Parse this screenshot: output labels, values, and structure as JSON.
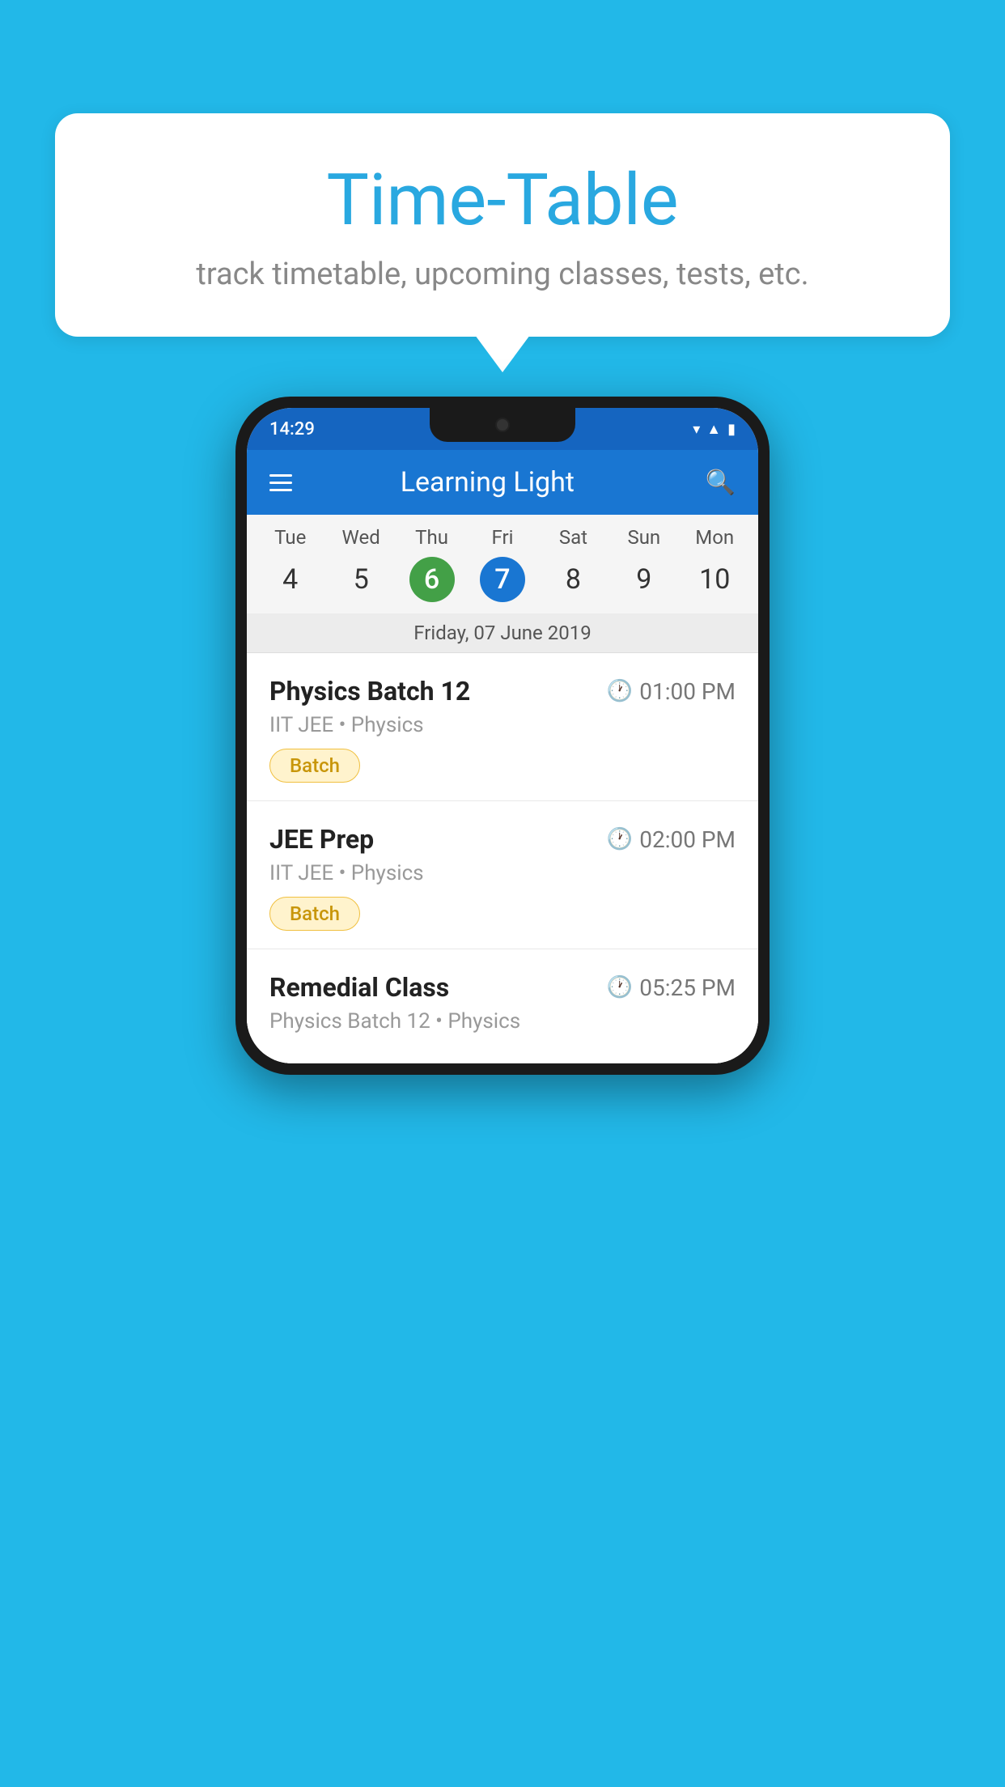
{
  "background_color": "#22b8e8",
  "bubble": {
    "title": "Time-Table",
    "subtitle": "track timetable, upcoming classes, tests, etc."
  },
  "phone": {
    "status_bar": {
      "time": "14:29"
    },
    "app_bar": {
      "title": "Learning Light"
    },
    "calendar": {
      "days": [
        "Tue",
        "Wed",
        "Thu",
        "Fri",
        "Sat",
        "Sun",
        "Mon"
      ],
      "dates": [
        {
          "num": "4",
          "type": "normal"
        },
        {
          "num": "5",
          "type": "normal"
        },
        {
          "num": "6",
          "type": "green"
        },
        {
          "num": "7",
          "type": "blue"
        },
        {
          "num": "8",
          "type": "normal"
        },
        {
          "num": "9",
          "type": "normal"
        },
        {
          "num": "10",
          "type": "normal"
        }
      ],
      "selected_date": "Friday, 07 June 2019"
    },
    "schedule": [
      {
        "title": "Physics Batch 12",
        "time": "01:00 PM",
        "subtitle": "IIT JEE • Physics",
        "tag": "Batch"
      },
      {
        "title": "JEE Prep",
        "time": "02:00 PM",
        "subtitle": "IIT JEE • Physics",
        "tag": "Batch"
      },
      {
        "title": "Remedial Class",
        "time": "05:25 PM",
        "subtitle": "Physics Batch 12 • Physics",
        "tag": ""
      }
    ]
  }
}
